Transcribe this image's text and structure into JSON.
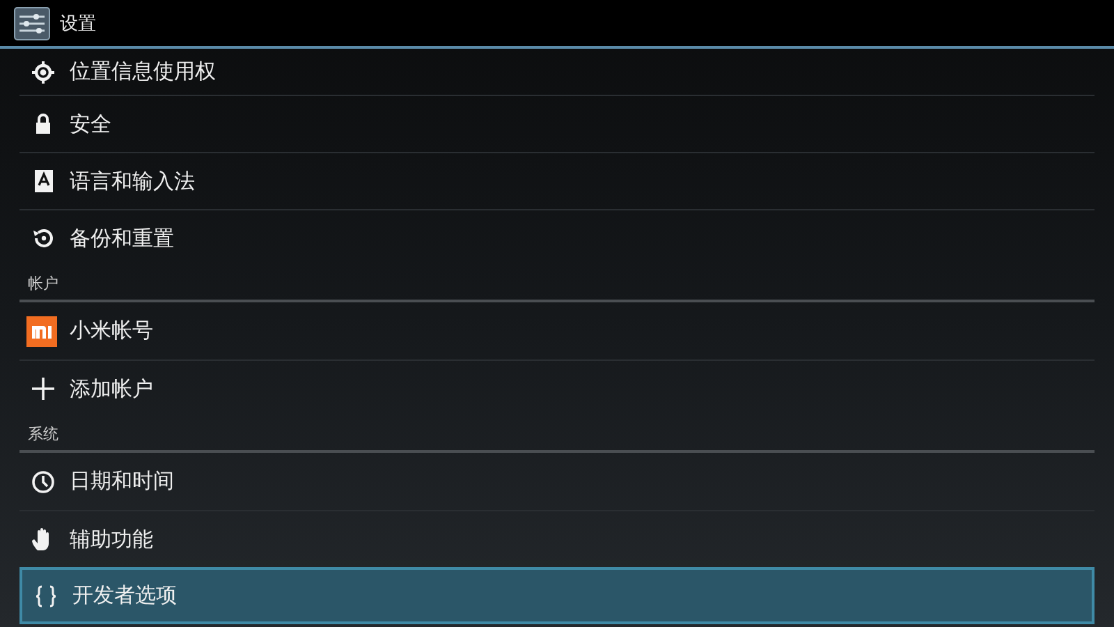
{
  "window": {
    "title": "设置"
  },
  "list": [
    {
      "kind": "item",
      "label": "位置信息使用权",
      "selected": false
    },
    {
      "kind": "item",
      "label": "安全",
      "selected": false
    },
    {
      "kind": "item",
      "label": "语言和输入法",
      "selected": false
    },
    {
      "kind": "item",
      "label": "备份和重置",
      "selected": false
    },
    {
      "kind": "header",
      "label": "帐户"
    },
    {
      "kind": "item",
      "label": "小米帐号",
      "selected": false
    },
    {
      "kind": "item",
      "label": "添加帐户",
      "selected": false
    },
    {
      "kind": "header",
      "label": "系统"
    },
    {
      "kind": "item",
      "label": "日期和时间",
      "selected": false
    },
    {
      "kind": "item",
      "label": "辅助功能",
      "selected": false
    },
    {
      "kind": "item",
      "label": "开发者选项",
      "selected": true
    }
  ]
}
